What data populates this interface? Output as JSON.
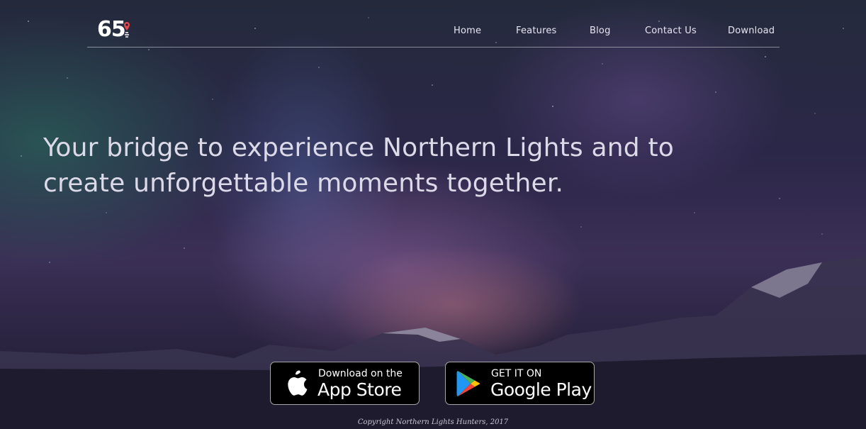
{
  "brand": {
    "logo_text": "65",
    "logo_icon": "map-pin-icon"
  },
  "nav": {
    "items": [
      {
        "label": "Home"
      },
      {
        "label": "Features"
      },
      {
        "label": "Blog"
      },
      {
        "label": "Contact Us"
      },
      {
        "label": "Download"
      }
    ]
  },
  "hero": {
    "headline": "Your bridge to experience Northern Lights and to create unforgettable moments together."
  },
  "downloads": {
    "app_store": {
      "small": "Download on the",
      "big": "App Store",
      "icon": "apple-icon"
    },
    "google_play": {
      "small": "GET IT ON",
      "big": "Google Play",
      "icon": "google-play-icon"
    }
  },
  "footer": {
    "copyright": "Copyright Northern Lights Hunters, 2017"
  },
  "colors": {
    "nav_text": "#e8e6f2",
    "headline_text": "#dcd9e8",
    "button_bg": "#000000",
    "pin_accent": "#e04a4a"
  }
}
